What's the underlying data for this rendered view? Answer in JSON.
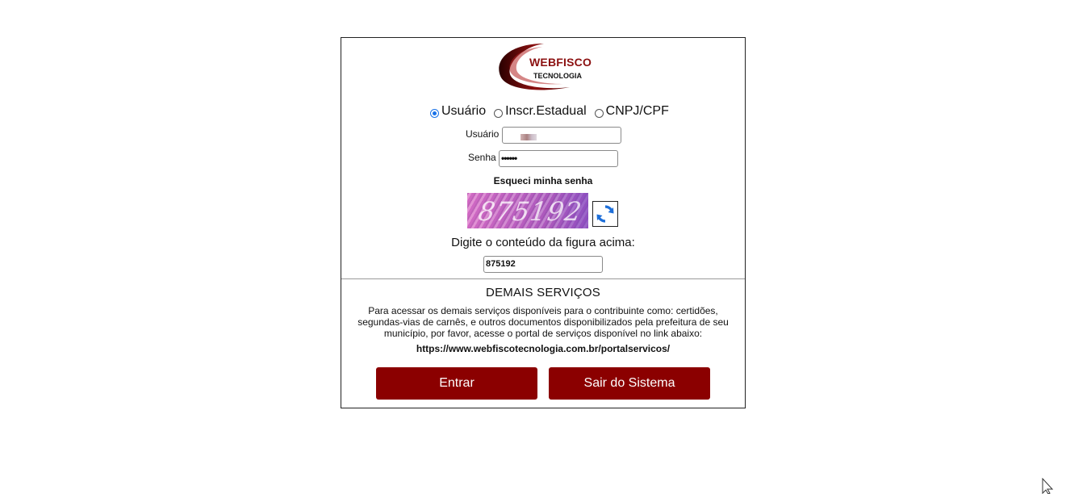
{
  "brand": {
    "name": "WEBFISCO",
    "subtitle": "TECNOLOGIA",
    "colors": {
      "primary": "#8b0000",
      "accent": "#1a73e8"
    }
  },
  "login_type": {
    "options": [
      {
        "label": "Usuário",
        "selected": true
      },
      {
        "label": "Inscr.Estadual",
        "selected": false
      },
      {
        "label": "CNPJ/CPF",
        "selected": false
      }
    ]
  },
  "form": {
    "user_label": "Usuário",
    "password_label": "Senha",
    "password_value": "••••••",
    "forgot_password": "Esqueci minha senha"
  },
  "captcha": {
    "image_text": "875192",
    "refresh_icon": "refresh-icon",
    "instruction": "Digite o conteúdo da figura acima:",
    "input_value": "875192"
  },
  "services": {
    "title": "DEMAIS SERVIÇOS",
    "description": "Para acessar os demais serviços disponíveis para o contribuinte como: certidões, segundas-vias de carnês, e outros documentos disponibilizados pela prefeitura de seu município, por favor, acesse o portal de serviços disponível no link abaixo:",
    "link": "https://www.webfiscotecnologia.com.br/portalservicos/"
  },
  "actions": {
    "enter_label": "Entrar",
    "exit_label": "Sair do Sistema"
  }
}
